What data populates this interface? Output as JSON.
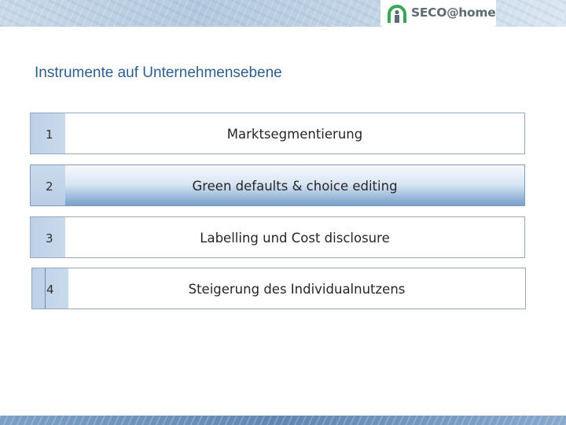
{
  "header": {
    "logo_text": "SECO@home",
    "logo_icon": "seco-home-logo-icon",
    "colors": {
      "logo_green": "#3aa556",
      "logo_gray": "#5d6b74",
      "banner_blue": "#b3c9de"
    }
  },
  "title": "Instrumente auf Unternehmensebene",
  "rows": [
    {
      "number": "1",
      "label": "Marktsegmentierung"
    },
    {
      "number": "2",
      "label": "Green defaults & choice editing"
    },
    {
      "number": "3",
      "label": "Labelling und Cost disclosure"
    },
    {
      "number": "4",
      "label": "Steigerung des Individualnutzens"
    }
  ],
  "colors": {
    "title": "#2d5e8f",
    "row_border": "#93a9c2",
    "number_block": "#c3d5e9",
    "highlight_row": "#8fb0d6"
  }
}
